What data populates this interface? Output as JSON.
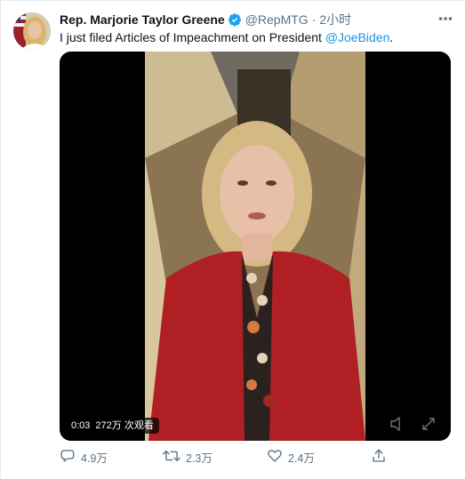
{
  "tweet": {
    "author_name": "Rep. Marjorie Taylor Greene",
    "handle": "@RepMTG",
    "separator": "·",
    "time": "2小时",
    "text_prefix": "I just filed Articles of Impeachment on President ",
    "mention": "@JoeBiden",
    "text_suffix": "."
  },
  "video": {
    "elapsed": "0:03",
    "views": "272万 次观看"
  },
  "actions": {
    "replies": "4.9万",
    "retweets": "2.3万",
    "likes": "2.4万"
  },
  "colors": {
    "accent": "#1b95e0",
    "verified": "#1da1f2",
    "muted": "#5b7083"
  }
}
